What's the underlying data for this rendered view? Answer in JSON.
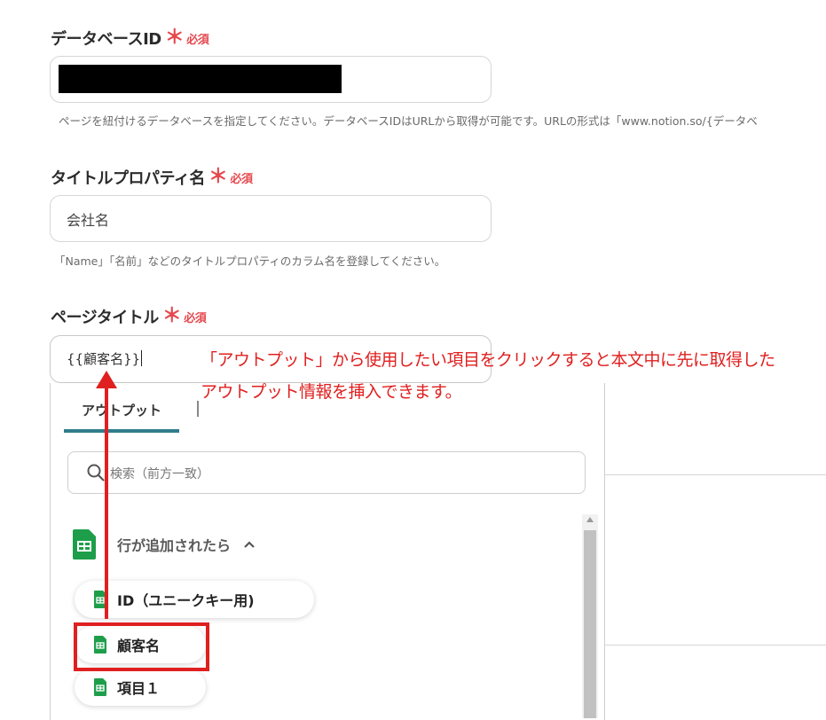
{
  "fields": {
    "database_id": {
      "label": "データベースID",
      "required_mark": "＊",
      "required_text": "必須",
      "help": "ページを紐付けるデータベースを指定してください。データベースIDはURLから取得が可能です。URLの形式は「www.notion.so/{データベ"
    },
    "title_property": {
      "label": "タイトルプロパティ名",
      "required_mark": "＊",
      "required_text": "必須",
      "value": "会社名",
      "help": "「Name」「名前」などのタイトルプロパティのカラム名を登録してください。"
    },
    "page_title": {
      "label": "ページタイトル",
      "required_mark": "＊",
      "required_text": "必須",
      "value": "{{顧客名}}"
    }
  },
  "dropdown": {
    "tab_label": "アウトプット",
    "search_placeholder": "検索（前方一致）",
    "group_label": "行が追加されたら",
    "items": [
      {
        "label": "ID（ユニークキー用)"
      },
      {
        "label": "顧客名"
      },
      {
        "label": "項目１"
      }
    ]
  },
  "annotation": {
    "line1": "「アウトプット」から使用したい項目をクリックすると本文中に先に取得した",
    "line2": "アウトプット情報を挿入できます。"
  },
  "colors": {
    "required": "#e5484d",
    "annotation": "#e02020",
    "tab_underline": "#2f7d8c",
    "sheets_green": "#1e9e4a"
  },
  "icons": [
    "search-icon",
    "chevron-up-icon",
    "sheets-icon"
  ]
}
